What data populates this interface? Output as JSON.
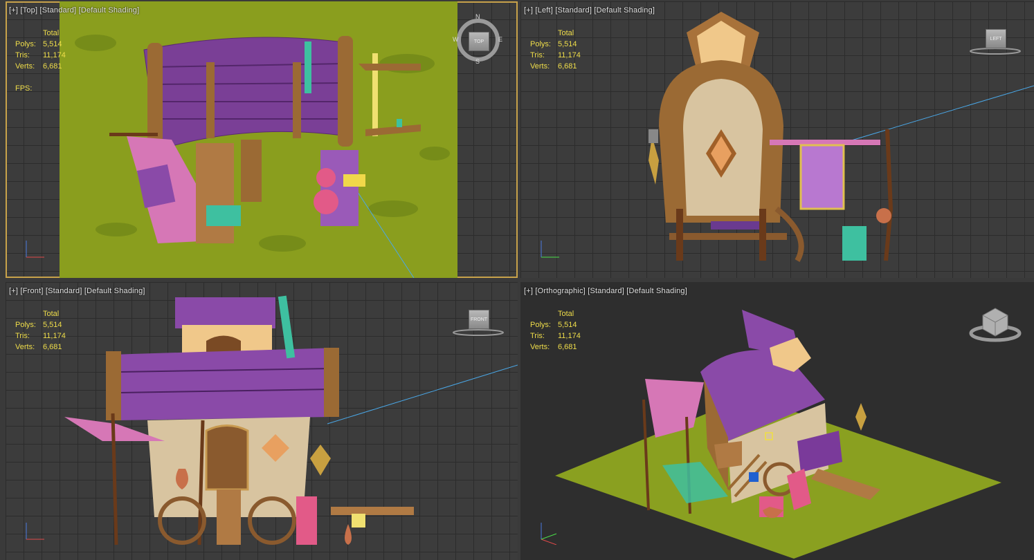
{
  "viewports": {
    "top": {
      "label": [
        "[+]",
        "[Top]",
        "[Standard]",
        "[Default Shading]"
      ],
      "stats": {
        "total": "Total",
        "polys_label": "Polys:",
        "polys": "5,514",
        "tris_label": "Tris:",
        "tris": "11,174",
        "verts_label": "Verts:",
        "verts": "6,681",
        "fps_label": "FPS:"
      },
      "compass": {
        "n": "N",
        "s": "S",
        "e": "E",
        "w": "W",
        "cube": "TOP"
      }
    },
    "left": {
      "label": [
        "[+]",
        "[Left]",
        "[Standard]",
        "[Default Shading]"
      ],
      "stats": {
        "total": "Total",
        "polys_label": "Polys:",
        "polys": "5,514",
        "tris_label": "Tris:",
        "tris": "11,174",
        "verts_label": "Verts:",
        "verts": "6,681"
      },
      "cube": "LEFT"
    },
    "front": {
      "label": [
        "[+]",
        "[Front]",
        "[Standard]",
        "[Default Shading]"
      ],
      "stats": {
        "total": "Total",
        "polys_label": "Polys:",
        "polys": "5,514",
        "tris_label": "Tris:",
        "tris": "11,174",
        "verts_label": "Verts:",
        "verts": "6,681"
      },
      "cube": "FRONT"
    },
    "ortho": {
      "label": [
        "[+]",
        "[Orthographic]",
        "[Standard]",
        "[Default Shading]"
      ],
      "stats": {
        "total": "Total",
        "polys_label": "Polys:",
        "polys": "5,514",
        "tris_label": "Tris:",
        "tris": "11,174",
        "verts_label": "Verts:",
        "verts": "6,681"
      }
    }
  },
  "colors": {
    "stats_text": "#f0de4a",
    "active_border": "#c8a24a",
    "grid": "#2c2c2c",
    "roof": "#8a4aa8",
    "wood": "#8a5a2e",
    "grass": "#8aa020"
  }
}
